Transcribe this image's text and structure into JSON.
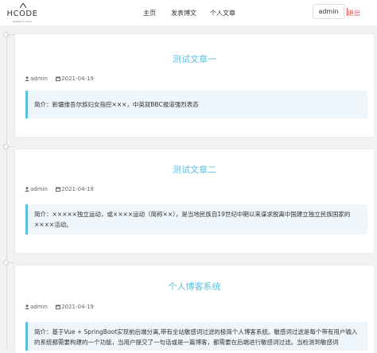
{
  "brand": {
    "name": "HCODE",
    "tagline": "Dreams in Code"
  },
  "nav": {
    "home": "主页",
    "publish": "发表博文",
    "my_articles": "个人文章"
  },
  "user": {
    "name": "admin",
    "logout": "退出"
  },
  "posts": [
    {
      "title": "测试文章一",
      "author": "admin",
      "date": "2021-04-19",
      "summary": "简介：新疆维吾尔族妇女指控×××，中英就BBC报道强烈表态"
    },
    {
      "title": "测试文章二",
      "author": "admin",
      "date": "2021-04-19",
      "summary": "简介：×××××独立运动，或××××运动（简称××），是当地民族自19世纪中期以来谋求脱离中国建立独立民族国家的××××活动。"
    },
    {
      "title": "个人博客系统",
      "author": "admin",
      "date": "2021-04-19",
      "summary": "简介：基于Vue + SpringBoot实现前后端分离,带有全站敏感词过滤的极简个人博客系统。敏感词过滤是每个带有用户输入的系统都需要构建的一个功能，当用户提交了一句话或是一篇博客，都需要在后端进行敏感词过滤。当检测到敏感词"
    }
  ],
  "colors": {
    "accent": "#5bc0de",
    "logout": "#d9534f",
    "summary_bg": "#eef6fb"
  }
}
